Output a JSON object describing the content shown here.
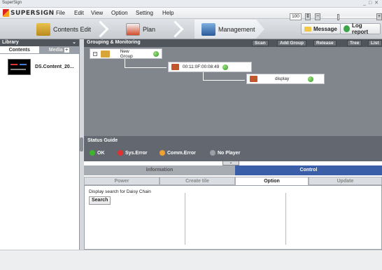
{
  "window": {
    "title": "SuperSign",
    "controls": "_ □ ✕"
  },
  "menu": {
    "logo_text": "SUPERSIGN",
    "items": [
      "File",
      "Edit",
      "View",
      "Option",
      "Setting",
      "Help"
    ]
  },
  "workflow": {
    "steps": [
      "Contents Edit",
      "Plan",
      "Management"
    ],
    "active": "Management",
    "message_button": "Message",
    "log_button": "Log report"
  },
  "library": {
    "title": "Library",
    "tabs": [
      "Contents",
      "Media"
    ],
    "item_label": "DS.Content_20..."
  },
  "monitoring": {
    "title": "Grouping & Monitoring",
    "buttons": [
      "Scan",
      "Add Group",
      "Release",
      "Tree",
      "List"
    ],
    "group_name": "New Group",
    "device_mac": "00:11:0F:00:08:49",
    "display_name": "display"
  },
  "status_guide": {
    "title": "Status Guide",
    "legend": [
      {
        "label": "OK",
        "color": "#3cb52a"
      },
      {
        "label": "Sys.Error",
        "color": "#e03030"
      },
      {
        "label": "Comm.Error",
        "color": "#f0a030"
      },
      {
        "label": "No Player",
        "color": "#9aa0a6"
      }
    ],
    "zoom": "100"
  },
  "control": {
    "segments": [
      "Information",
      "Control"
    ],
    "active_segment": "Control",
    "tabs": [
      "Power",
      "Create tile",
      "Option",
      "Update"
    ],
    "active_tab": "Option",
    "option_text": "Display search for Daisy Chain",
    "search_button": "Search"
  },
  "colors": {
    "accent_blue": "#3a5ea8",
    "dark_header": "#50555c",
    "monitor_bg": "#81868d"
  }
}
